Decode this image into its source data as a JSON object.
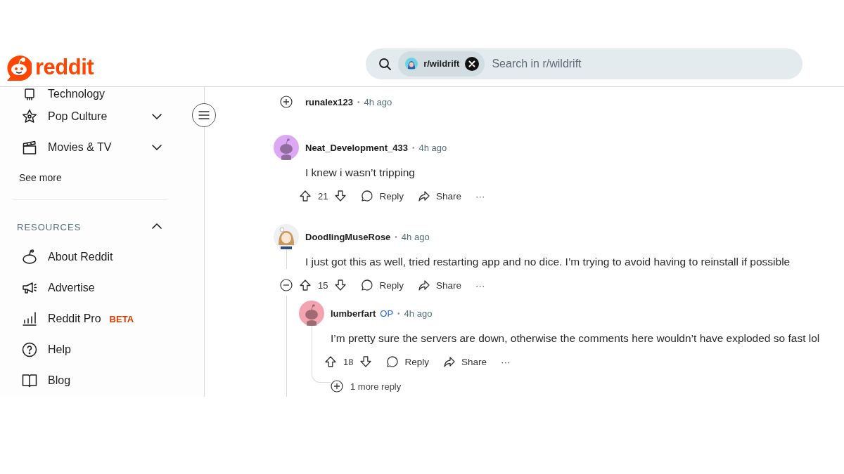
{
  "header": {
    "logo_text": "reddit",
    "search": {
      "chip": "r/wildrift",
      "placeholder": "Search in r/wildrift"
    }
  },
  "sidebar": {
    "items": [
      {
        "label": "Technology",
        "kind": "chip"
      },
      {
        "label": "Pop Culture",
        "kind": "star",
        "expanded": false
      },
      {
        "label": "Movies & TV",
        "kind": "clapper",
        "expanded": false
      }
    ],
    "see_more": "See more",
    "sections": [
      {
        "title": "RESOURCES",
        "expanded": true,
        "items": [
          {
            "label": "About Reddit",
            "kind": "snoo"
          },
          {
            "label": "Advertise",
            "kind": "megaphone"
          },
          {
            "label": "Reddit Pro",
            "kind": "bars",
            "badge": "BETA"
          },
          {
            "label": "Help",
            "kind": "question"
          },
          {
            "label": "Blog",
            "kind": "book"
          }
        ]
      }
    ]
  },
  "comments": [
    {
      "author": "runalex123",
      "separator": "•",
      "time": "4h ago",
      "expanded": false
    },
    {
      "author": "Neat_Development_433",
      "separator": "•",
      "time": "4h ago",
      "avatar": {
        "kind": "snoo",
        "color": "#dda8f3"
      },
      "text": "I knew i wasn’t tripping",
      "votes": "21",
      "reply": "Reply",
      "share": "Share",
      "more": "···"
    },
    {
      "author": "DoodlingMuseRose",
      "separator": "•",
      "time": "4h ago",
      "expanded": true,
      "avatar": {
        "kind": "drawing"
      },
      "text": "I just got this as well, tried restarting app and no dice. I’m trying to avoid having to reinstall if possible",
      "votes": "15",
      "reply": "Reply",
      "share": "Share",
      "more": "···",
      "children": [
        {
          "author": "lumberfart",
          "op": "OP",
          "separator": "•",
          "time": "4h ago",
          "avatar": {
            "kind": "snoo",
            "color": "#f4a3b0"
          },
          "text": "I’m pretty sure the servers are down, otherwise the comments here wouldn’t have exploded so fast lol",
          "votes": "18",
          "reply": "Reply",
          "share": "Share",
          "more": "···",
          "more_replies": "1 more reply"
        }
      ]
    }
  ]
}
